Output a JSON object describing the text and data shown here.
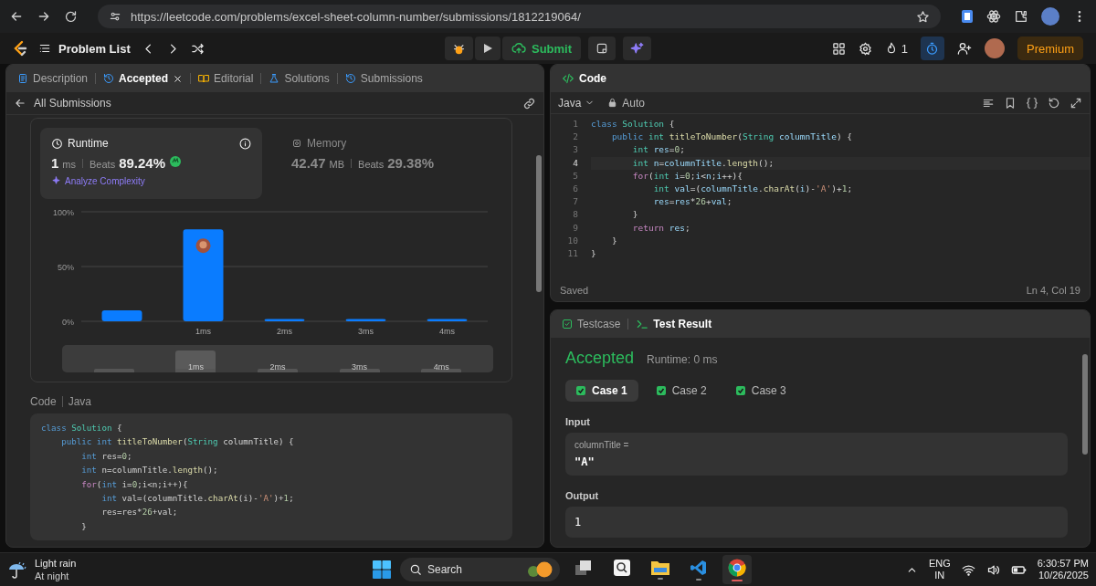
{
  "browser": {
    "url": "https://leetcode.com/problems/excel-sheet-column-number/submissions/1812219064/"
  },
  "nav": {
    "title": "Problem List",
    "submit": "Submit",
    "streak": "1",
    "premium": "Premium",
    "timer_active": true
  },
  "left_panel": {
    "tabs": [
      {
        "label": "Description",
        "kind": "doc",
        "selected": false,
        "closable": false
      },
      {
        "label": "Accepted",
        "kind": "history",
        "selected": true,
        "closable": true
      },
      {
        "label": "Editorial",
        "kind": "book",
        "selected": false,
        "closable": false
      },
      {
        "label": "Solutions",
        "kind": "flask",
        "selected": false,
        "closable": false
      },
      {
        "label": "Submissions",
        "kind": "history",
        "selected": false,
        "closable": false
      }
    ],
    "back_label": "All Submissions",
    "runtime": {
      "title": "Runtime",
      "value": "1",
      "unit": "ms",
      "beats_label": "Beats",
      "beats": "89.24%",
      "selected": true,
      "analyze": "Analyze Complexity"
    },
    "memory": {
      "title": "Memory",
      "value": "42.47",
      "unit": "MB",
      "beats_label": "Beats",
      "beats": "29.38%",
      "selected": false
    },
    "chart_data": {
      "type": "bar",
      "categories": [
        null,
        "1ms",
        "2ms",
        "3ms",
        "4ms"
      ],
      "values": [
        10,
        84,
        2,
        2,
        2
      ],
      "ylim": [
        0,
        100
      ],
      "yticks": [
        {
          "value": 0,
          "label": "0%"
        },
        {
          "value": 50,
          "label": "50%"
        },
        {
          "value": 100,
          "label": "100%"
        }
      ]
    },
    "user_marker": [
      false,
      true,
      false,
      false,
      false
    ],
    "navigator": {
      "slots": [
        {
          "selected": false
        },
        {
          "label": "1ms",
          "selected": true
        },
        {
          "label": "2ms",
          "selected": false
        },
        {
          "label": "3ms",
          "selected": false
        },
        {
          "label": "4ms",
          "selected": false
        }
      ]
    },
    "code_section": {
      "title": "Code",
      "language": "Java",
      "lines": [
        [
          {
            "kind": "kw",
            "text": "class"
          },
          {
            "kind": "type",
            "text": " Solution"
          },
          {
            "kind": "p",
            "text": " {"
          }
        ],
        [
          {
            "kind": "kw",
            "text": "    public int"
          },
          {
            "kind": "fn",
            "text": " titleToNumber"
          },
          {
            "kind": "p",
            "text": "("
          },
          {
            "kind": "type",
            "text": "String"
          },
          {
            "kind": "p",
            "text": " columnTitle) {"
          }
        ],
        [
          {
            "kind": "kw",
            "text": "        int"
          },
          {
            "kind": "p",
            "text": " res="
          },
          {
            "kind": "num",
            "text": "0"
          },
          {
            "kind": "p",
            "text": ";"
          }
        ],
        [
          {
            "kind": "kw",
            "text": "        int"
          },
          {
            "kind": "p",
            "text": " n=columnTitle."
          },
          {
            "kind": "fn",
            "text": "length"
          },
          {
            "kind": "p",
            "text": "();"
          }
        ],
        [
          {
            "kind": "ctrl",
            "text": "        for"
          },
          {
            "kind": "p",
            "text": "("
          },
          {
            "kind": "kw",
            "text": "int"
          },
          {
            "kind": "p",
            "text": " i="
          },
          {
            "kind": "num",
            "text": "0"
          },
          {
            "kind": "p",
            "text": ";i<n;i++){"
          }
        ],
        [
          {
            "kind": "kw",
            "text": "            int"
          },
          {
            "kind": "p",
            "text": " val=(columnTitle."
          },
          {
            "kind": "fn",
            "text": "charAt"
          },
          {
            "kind": "p",
            "text": "(i)-"
          },
          {
            "kind": "str",
            "text": "'A'"
          },
          {
            "kind": "p",
            "text": ")+"
          },
          {
            "kind": "num",
            "text": "1"
          },
          {
            "kind": "p",
            "text": ";"
          }
        ],
        [
          {
            "kind": "p",
            "text": "            res=res*"
          },
          {
            "kind": "num",
            "text": "26"
          },
          {
            "kind": "p",
            "text": "+val;"
          }
        ],
        [
          {
            "kind": "p",
            "text": "        }"
          }
        ]
      ]
    }
  },
  "editor": {
    "title": "Code",
    "language": "Java",
    "mode": "Auto",
    "lines": [
      {
        "number": "1",
        "current": false,
        "tokens": [
          {
            "kind": "kw",
            "text": "class"
          },
          {
            "kind": "type",
            "text": " Solution"
          },
          {
            "kind": "p",
            "text": " {"
          }
        ]
      },
      {
        "number": "2",
        "current": false,
        "tokens": [
          {
            "kind": "kw",
            "text": "    public"
          },
          {
            "kind": "type",
            "text": " int"
          },
          {
            "kind": "fn",
            "text": " titleToNumber"
          },
          {
            "kind": "p",
            "text": "("
          },
          {
            "kind": "type",
            "text": "String"
          },
          {
            "kind": "var",
            "text": " columnTitle"
          },
          {
            "kind": "p",
            "text": ") {"
          }
        ]
      },
      {
        "number": "3",
        "current": false,
        "tokens": [
          {
            "kind": "type",
            "text": "        int"
          },
          {
            "kind": "var",
            "text": " res"
          },
          {
            "kind": "p",
            "text": "="
          },
          {
            "kind": "num",
            "text": "0"
          },
          {
            "kind": "p",
            "text": ";"
          }
        ]
      },
      {
        "number": "4",
        "current": true,
        "tokens": [
          {
            "kind": "type",
            "text": "        int"
          },
          {
            "kind": "var",
            "text": " n"
          },
          {
            "kind": "p",
            "text": "="
          },
          {
            "kind": "var",
            "text": "columnTitle"
          },
          {
            "kind": "p",
            "text": "."
          },
          {
            "kind": "fn",
            "text": "length"
          },
          {
            "kind": "p",
            "text": "();"
          }
        ]
      },
      {
        "number": "5",
        "current": false,
        "tokens": [
          {
            "kind": "ctrl",
            "text": "        for"
          },
          {
            "kind": "p",
            "text": "("
          },
          {
            "kind": "type",
            "text": "int"
          },
          {
            "kind": "var",
            "text": " i"
          },
          {
            "kind": "p",
            "text": "="
          },
          {
            "kind": "num",
            "text": "0"
          },
          {
            "kind": "p",
            "text": ";"
          },
          {
            "kind": "var",
            "text": "i"
          },
          {
            "kind": "p",
            "text": "<"
          },
          {
            "kind": "var",
            "text": "n"
          },
          {
            "kind": "p",
            "text": ";"
          },
          {
            "kind": "var",
            "text": "i"
          },
          {
            "kind": "p",
            "text": "++){"
          }
        ]
      },
      {
        "number": "6",
        "current": false,
        "tokens": [
          {
            "kind": "type",
            "text": "            int"
          },
          {
            "kind": "var",
            "text": " val"
          },
          {
            "kind": "p",
            "text": "=("
          },
          {
            "kind": "var",
            "text": "columnTitle"
          },
          {
            "kind": "p",
            "text": "."
          },
          {
            "kind": "fn",
            "text": "charAt"
          },
          {
            "kind": "p",
            "text": "("
          },
          {
            "kind": "var",
            "text": "i"
          },
          {
            "kind": "p",
            "text": ")-"
          },
          {
            "kind": "str",
            "text": "'A'"
          },
          {
            "kind": "p",
            "text": ")+"
          },
          {
            "kind": "num",
            "text": "1"
          },
          {
            "kind": "p",
            "text": ";"
          }
        ]
      },
      {
        "number": "7",
        "current": false,
        "tokens": [
          {
            "kind": "var",
            "text": "            res"
          },
          {
            "kind": "p",
            "text": "="
          },
          {
            "kind": "var",
            "text": "res"
          },
          {
            "kind": "p",
            "text": "*"
          },
          {
            "kind": "num",
            "text": "26"
          },
          {
            "kind": "p",
            "text": "+"
          },
          {
            "kind": "var",
            "text": "val"
          },
          {
            "kind": "p",
            "text": ";"
          }
        ]
      },
      {
        "number": "8",
        "current": false,
        "tokens": [
          {
            "kind": "p",
            "text": "        }"
          }
        ]
      },
      {
        "number": "9",
        "current": false,
        "tokens": [
          {
            "kind": "ctrl",
            "text": "        return"
          },
          {
            "kind": "var",
            "text": " res"
          },
          {
            "kind": "p",
            "text": ";"
          }
        ]
      },
      {
        "number": "10",
        "current": false,
        "tokens": [
          {
            "kind": "p",
            "text": "    }"
          }
        ]
      },
      {
        "number": "11",
        "current": false,
        "tokens": [
          {
            "kind": "p",
            "text": "}"
          }
        ]
      }
    ],
    "status": "Saved",
    "cursor": "Ln 4, Col 19"
  },
  "result_panel": {
    "tabs": [
      {
        "label": "Testcase",
        "kind": "check",
        "selected": false
      },
      {
        "label": "Test Result",
        "kind": "terminal",
        "selected": true
      }
    ],
    "verdict": "Accepted",
    "runtime": "Runtime: 0 ms",
    "cases": [
      {
        "label": "Case 1",
        "passed": true,
        "selected": true
      },
      {
        "label": "Case 2",
        "passed": true,
        "selected": false
      },
      {
        "label": "Case 3",
        "passed": true,
        "selected": false
      }
    ],
    "input_label": "Input",
    "inputs": [
      {
        "name": "columnTitle =",
        "value": "\"A\""
      }
    ],
    "output_label": "Output",
    "output": "1"
  },
  "taskbar": {
    "weather": {
      "condition": "Light rain",
      "period": "At night"
    },
    "search_placeholder": "Search",
    "apps": [
      {
        "kind": "taskview",
        "running": false,
        "selected": false
      },
      {
        "kind": "finder",
        "running": false,
        "selected": false
      },
      {
        "kind": "folder",
        "running": true,
        "selected": false
      },
      {
        "kind": "vscode",
        "running": true,
        "selected": false
      },
      {
        "kind": "chrome",
        "running": true,
        "selected": true
      }
    ],
    "language": "ENG",
    "region": "IN",
    "time": "6:30:57 PM",
    "date": "10/26/2025"
  }
}
